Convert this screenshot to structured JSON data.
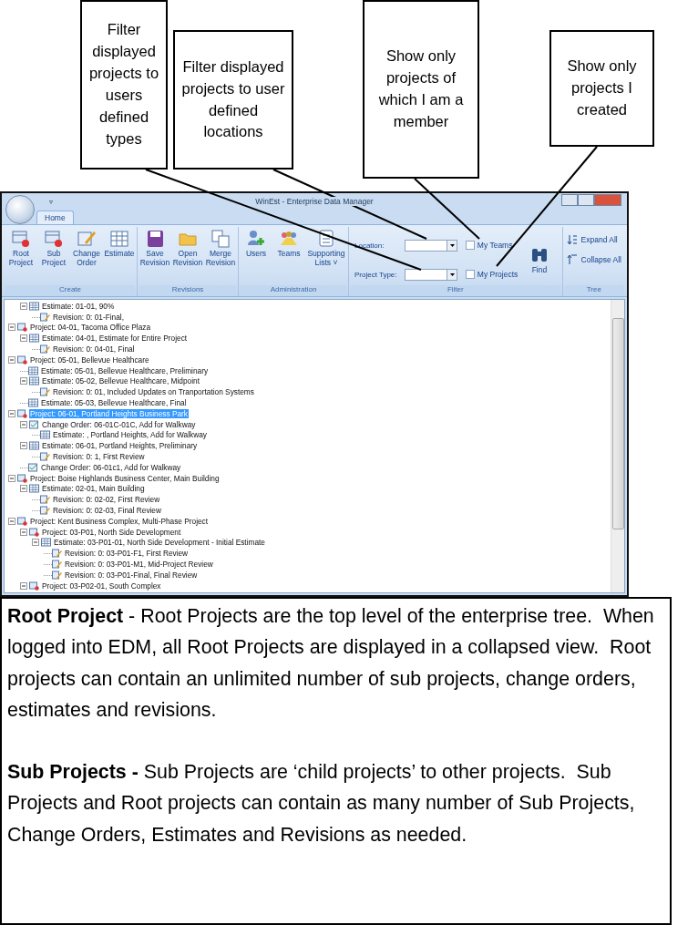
{
  "callouts": [
    {
      "text": "Filter displayed projects to users defined types"
    },
    {
      "text": "Filter displayed projects to user defined locations"
    },
    {
      "text": "Show only projects of which I am a member"
    },
    {
      "text": "Show only projects I created"
    }
  ],
  "window": {
    "title": "WinEst - Enterprise Data Manager",
    "quick_access": "▿"
  },
  "tabs": [
    {
      "label": "Home",
      "selected": true
    }
  ],
  "ribbon": [
    {
      "label": "Create",
      "buttons": [
        {
          "kind": "root_project",
          "label": "Root Project"
        },
        {
          "kind": "sub_project",
          "label": "Sub Project"
        },
        {
          "kind": "change_order",
          "label": "Change Order"
        },
        {
          "kind": "estimate",
          "label": "Estimate"
        }
      ]
    },
    {
      "label": "Revisions",
      "buttons": [
        {
          "kind": "save",
          "label": "Save Revision"
        },
        {
          "kind": "open",
          "label": "Open Revision"
        },
        {
          "kind": "merge",
          "label": "Merge Revision"
        }
      ]
    },
    {
      "label": "Administration",
      "buttons": [
        {
          "kind": "users",
          "label": "Users"
        },
        {
          "kind": "teams",
          "label": "Teams"
        },
        {
          "kind": "list",
          "label": "Supporting Lists ˅"
        }
      ]
    }
  ],
  "filter": {
    "label": "Filter",
    "fields": [
      {
        "label": "Location:"
      },
      {
        "label": "Project Type:"
      }
    ],
    "checkboxes": [
      {
        "label": "My Teams",
        "checked": false
      },
      {
        "label": "My Projects",
        "checked": false
      }
    ],
    "find": "Find"
  },
  "tree_group": {
    "label": "Tree",
    "buttons": [
      {
        "kind": "expand",
        "label": "Expand All"
      },
      {
        "kind": "collapse",
        "label": "Collapse All"
      }
    ]
  },
  "tree": {
    "continued": [
      {
        "kind": "estimate",
        "label": "Estimate: 01-01, 90%",
        "selected": false,
        "expanded": true,
        "children": [
          {
            "kind": "revision",
            "label": "Revision: 0: 01-Final,",
            "selected": false
          }
        ]
      }
    ],
    "items": [
      {
        "kind": "project",
        "label": "Project: 04-01, Tacoma Office Plaza",
        "selected": false,
        "expanded": true,
        "children": [
          {
            "kind": "estimate",
            "label": "Estimate: 04-01, Estimate for Entire Project",
            "selected": false,
            "expanded": true,
            "children": [
              {
                "kind": "revision",
                "label": "Revision: 0: 04-01, Final",
                "selected": false
              }
            ]
          }
        ]
      },
      {
        "kind": "project",
        "label": "Project: 05-01, Bellevue Healthcare",
        "selected": false,
        "expanded": true,
        "children": [
          {
            "kind": "estimate",
            "label": "Estimate: 05-01, Bellevue Healthcare, Preliminary",
            "selected": false
          },
          {
            "kind": "estimate",
            "label": "Estimate: 05-02, Bellevue Healthcare, Midpoint",
            "selected": false,
            "expanded": true,
            "children": [
              {
                "kind": "revision",
                "label": "Revision: 0: 01, Included Updates on Tranportation Systems",
                "selected": false
              }
            ]
          },
          {
            "kind": "estimate",
            "label": "Estimate: 05-03, Bellevue Healthcare, Final",
            "selected": false
          }
        ]
      },
      {
        "kind": "project",
        "label": "Project: 06-01, Portland Heights Business Park",
        "selected": true,
        "expanded": true,
        "children": [
          {
            "kind": "change_order",
            "label": "Change Order: 06-01C-01C, Add for Walkway",
            "selected": false,
            "expanded": true,
            "children": [
              {
                "kind": "estimate",
                "label": "Estimate: , Portland Heights, Add for Walkway",
                "selected": false
              }
            ]
          },
          {
            "kind": "estimate",
            "label": "Estimate: 06-01, Portland Heights, Preliminary",
            "selected": false,
            "expanded": true,
            "children": [
              {
                "kind": "revision",
                "label": "Revision: 0: 1, First Review",
                "selected": false
              }
            ]
          },
          {
            "kind": "change_order",
            "label": "Change Order: 06-01c1, Add for Walkway",
            "selected": false
          }
        ]
      },
      {
        "kind": "project",
        "label": "Project: Boise Highlands Business Center, Main Building",
        "selected": false,
        "expanded": true,
        "children": [
          {
            "kind": "estimate",
            "label": "Estimate: 02-01, Main Building",
            "selected": false,
            "expanded": true,
            "children": [
              {
                "kind": "revision",
                "label": "Revision: 0: 02-02, First Review",
                "selected": false
              },
              {
                "kind": "revision",
                "label": "Revision: 0: 02-03, Final Review",
                "selected": false
              }
            ]
          }
        ]
      },
      {
        "kind": "project",
        "label": "Project: Kent Business Complex, Multi-Phase Project",
        "selected": false,
        "expanded": true,
        "children": [
          {
            "kind": "project",
            "label": "Project: 03-P01, North Side Development",
            "selected": false,
            "expanded": true,
            "children": [
              {
                "kind": "estimate",
                "label": "Estimate: 03-P01-01, North Side Development - Initial Estimate",
                "selected": false,
                "expanded": true,
                "children": [
                  {
                    "kind": "revision",
                    "label": "Revision: 0: 03-P01-F1, First Review",
                    "selected": false
                  },
                  {
                    "kind": "revision",
                    "label": "Revision: 0: 03-P01-M1, Mid-Project Review",
                    "selected": false
                  },
                  {
                    "kind": "revision",
                    "label": "Revision: 0: 03-P01-Final, Final Review",
                    "selected": false
                  }
                ]
              }
            ]
          },
          {
            "kind": "project",
            "label": "Project: 03-P02-01, South Complex",
            "selected": false,
            "expanded": true
          }
        ]
      }
    ]
  },
  "description": [
    "**Root Project** - Root Projects are the top level of the enterprise tree.  When logged into EDM, all Root Projects are displayed in a collapsed view.  Root projects can contain an unlimited number of sub projects, change orders, estimates and revisions.",
    "**Sub Projects -** Sub Projects are ‘child projects’ to other projects.  Sub Projects and Root projects can contain as many number of Sub Projects, Change Orders, Estimates and Revisions as needed."
  ]
}
